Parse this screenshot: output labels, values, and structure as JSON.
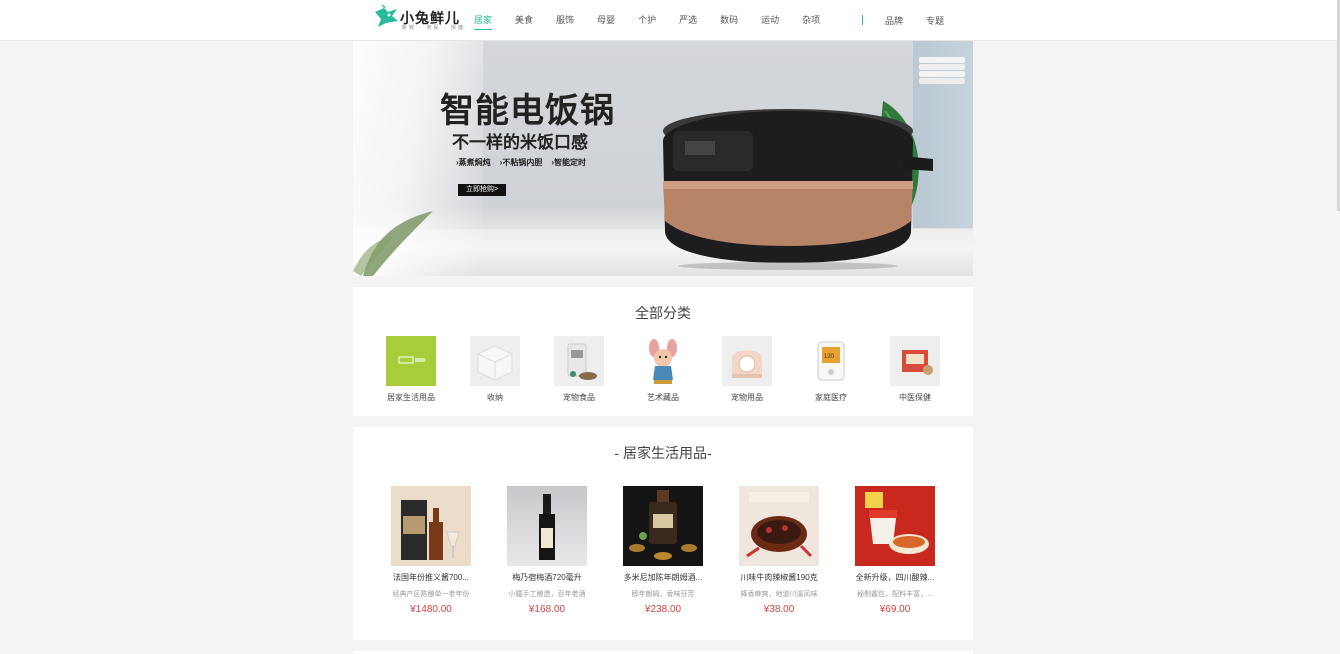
{
  "header": {
    "logo_text": "小兔鲜儿",
    "logo_sub": "新鲜 · 亲民 · 快捷",
    "nav": [
      "居家",
      "美食",
      "服饰",
      "母婴",
      "个护",
      "严选",
      "数码",
      "运动",
      "杂项"
    ],
    "nav_active": "居家",
    "nav_right": [
      "品牌",
      "专题"
    ]
  },
  "banner": {
    "title": "智能电饭锅",
    "subtitle": "不一样的米饭口感",
    "features": [
      "›蒸煮焖炖",
      "›不粘锅内胆",
      "›智能定时"
    ],
    "button": "立即抢购>"
  },
  "categories": {
    "title": "全部分类",
    "items": [
      {
        "label": "居家生活用品",
        "icon": "home-goods-image"
      },
      {
        "label": "收纳",
        "icon": "storage-box-image"
      },
      {
        "label": "宠物食品",
        "icon": "pet-food-image"
      },
      {
        "label": "艺术藏品",
        "icon": "art-figurine-image"
      },
      {
        "label": "宠物用品",
        "icon": "pet-supplies-image"
      },
      {
        "label": "家庭医疗",
        "icon": "blood-pressure-monitor-image"
      },
      {
        "label": "中医保健",
        "icon": "herbal-care-image"
      }
    ]
  },
  "products": {
    "title": "- 居家生活用品-",
    "items": [
      {
        "name": "法国年份推义酱700...",
        "desc": "经典产区陈酿单一老年份",
        "price": "¥1480.00"
      },
      {
        "name": "梅乃宿梅酒720毫升",
        "desc": "小鐵手工酿造，百年老酒",
        "price": "¥168.00"
      },
      {
        "name": "多米尼加陈年朗姆酒...",
        "desc": "醇年朗姆，香味芬芳",
        "price": "¥238.00"
      },
      {
        "name": "川味牛肉辣椒酱190克",
        "desc": "降香麻爽，地道川渝风味",
        "price": "¥38.00"
      },
      {
        "name": "全新升级，四川酸辣...",
        "desc": "秘制酱包，配料丰富，...",
        "price": "¥69.00"
      }
    ]
  },
  "colors": {
    "accent": "#27ba9b",
    "price": "#cf4444",
    "category_highlight": "#a8cc3a"
  }
}
